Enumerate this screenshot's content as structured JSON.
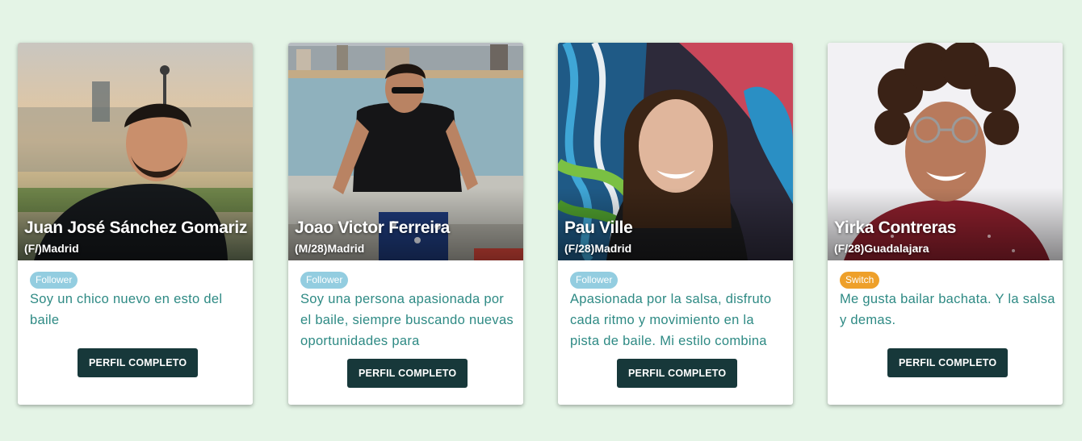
{
  "profiles": [
    {
      "name": "Juan José Sánchez Gomariz",
      "meta": "(F/)Madrid",
      "role": "Follower",
      "bio": "Soy un chico nuevo en esto del baile",
      "button_label": "PERFIL COMPLETO",
      "role_color": "#93cde0"
    },
    {
      "name": "Joao Victor Ferreira",
      "meta": "(M/28)Madrid",
      "role": "Follower",
      "bio": "Soy una persona apasionada por el baile, siempre buscando nuevas oportunidades para",
      "button_label": "PERFIL COMPLETO",
      "role_color": "#93cde0"
    },
    {
      "name": "Pau Ville",
      "meta": "(F/28)Madrid",
      "role": "Follower",
      "bio": "Apasionada por la salsa, disfruto cada ritmo y movimiento en la pista de baile. Mi estilo combina",
      "button_label": "PERFIL COMPLETO",
      "role_color": "#93cde0"
    },
    {
      "name": "Yirka Contreras",
      "meta": "(F/28)Guadalajara",
      "role": "Switch",
      "bio": "Me gusta bailar bachata. Y la salsa y demas.",
      "button_label": "PERFIL COMPLETO",
      "role_color": "#eea02a"
    }
  ],
  "colors": {
    "page_background": "#e4f4e6",
    "bio_text": "#2e8a84",
    "button": "#17383a"
  }
}
